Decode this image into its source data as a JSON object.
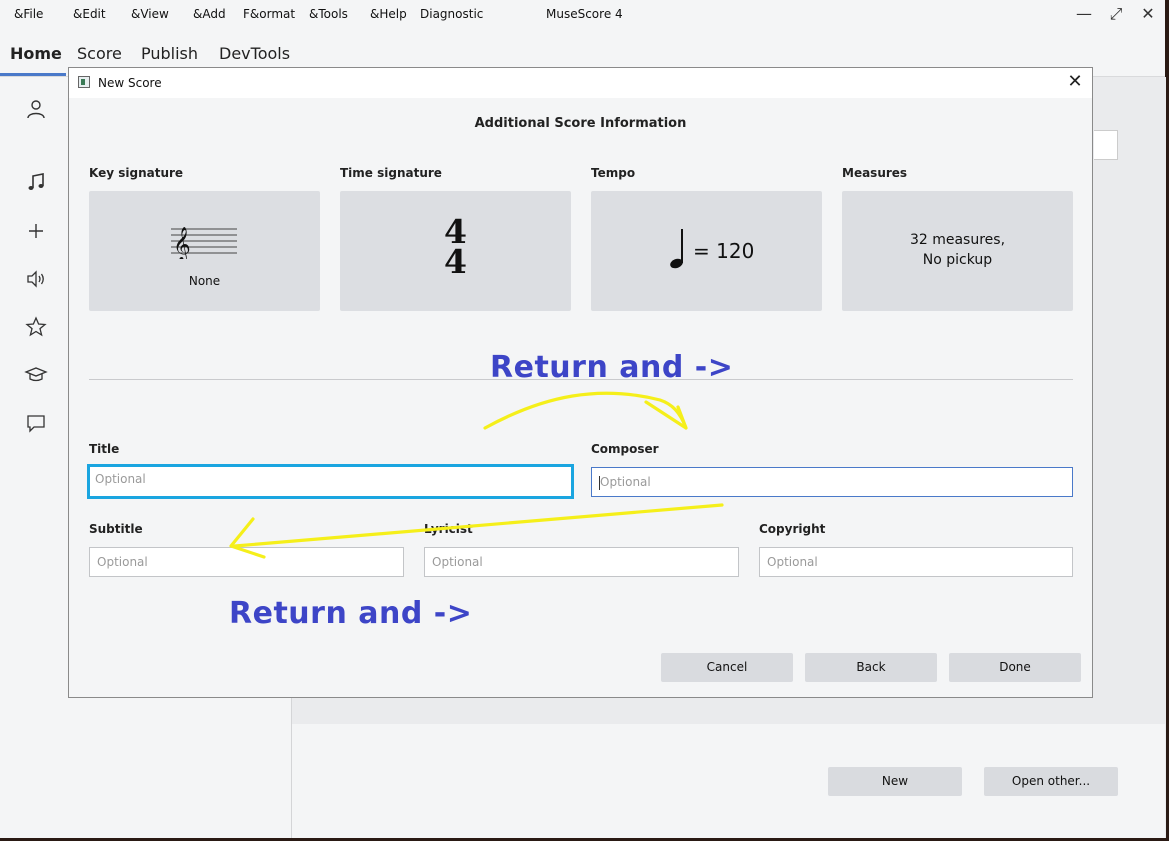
{
  "menubar": {
    "items": [
      "&File",
      "&Edit",
      "&View",
      "&Add",
      "F&ormat",
      "&Tools",
      "&Help",
      "Diagnostic"
    ],
    "app_title": "MuseScore 4"
  },
  "tabs": [
    "Home",
    "Score",
    "Publish",
    "DevTools"
  ],
  "sidebar": {
    "icons": [
      "account-icon",
      "scores-icon",
      "plugins-icon",
      "audio-icon",
      "musescore-com-icon",
      "learn-icon",
      "feedback-icon"
    ]
  },
  "main": {
    "new_button": "New",
    "open_other_button": "Open other..."
  },
  "dialog": {
    "title": "New Score",
    "heading": "Additional Score Information",
    "key_signature": {
      "label": "Key signature",
      "value": "None"
    },
    "time_signature": {
      "label": "Time signature",
      "top": "4",
      "bottom": "4"
    },
    "tempo": {
      "label": "Tempo",
      "value": "= 120"
    },
    "measures": {
      "label": "Measures",
      "line1": "32 measures,",
      "line2": "No pickup"
    },
    "fields": {
      "title": {
        "label": "Title",
        "placeholder": "Optional"
      },
      "composer": {
        "label": "Composer",
        "placeholder": "Optional"
      },
      "subtitle": {
        "label": "Subtitle",
        "placeholder": "Optional"
      },
      "lyricist": {
        "label": "Lyricist",
        "placeholder": "Optional"
      },
      "copyright": {
        "label": "Copyright",
        "placeholder": "Optional"
      }
    },
    "buttons": {
      "cancel": "Cancel",
      "back": "Back",
      "done": "Done"
    }
  },
  "annotations": {
    "top": "Return and ->",
    "bottom": "Return and ->",
    "text_color": "#3d45c7",
    "arrow_color": "#f5ef1a"
  },
  "colors": {
    "focus_border": "#1aa5e0",
    "accent": "#4a79c9"
  }
}
